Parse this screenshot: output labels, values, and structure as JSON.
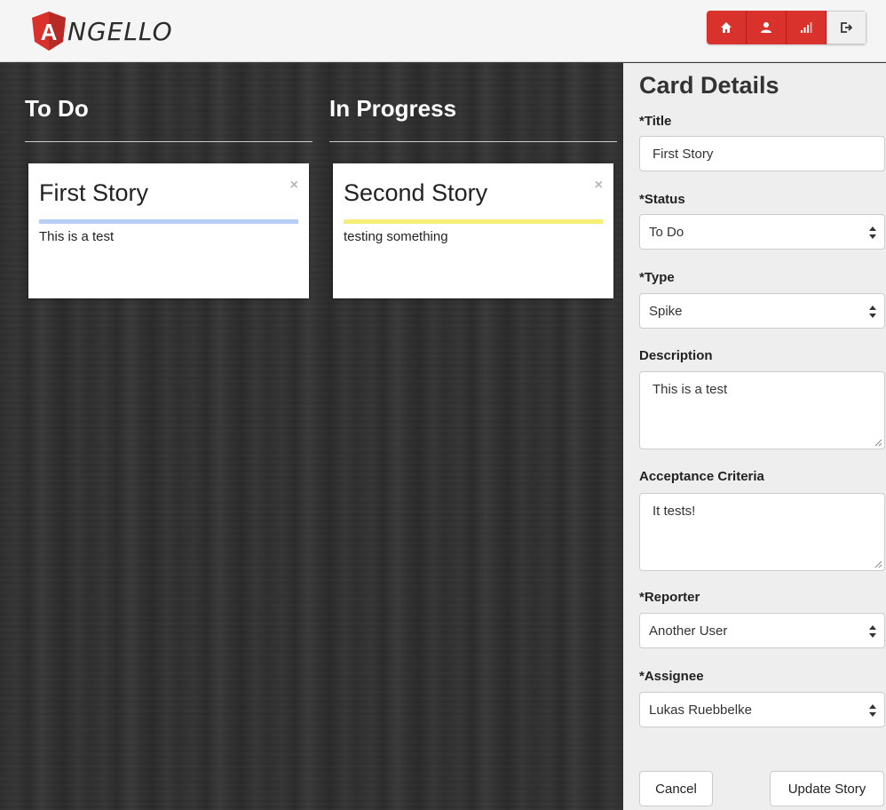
{
  "header": {
    "logo_text": "NGELLO",
    "logo_letter": "A",
    "nav": [
      {
        "icon": "home-icon"
      },
      {
        "icon": "user-icon"
      },
      {
        "icon": "signal-icon"
      },
      {
        "icon": "logout-icon"
      }
    ]
  },
  "board": {
    "columns": [
      {
        "title": "To Do",
        "cards": [
          {
            "title": "First Story",
            "description": "This is a test",
            "bar_color": "#b8cff5",
            "close": "×"
          }
        ]
      },
      {
        "title": "In Progress",
        "cards": [
          {
            "title": "Second Story",
            "description": "testing something",
            "bar_color": "#f7ee78",
            "close": "×"
          }
        ]
      }
    ]
  },
  "details": {
    "heading": "Card Details",
    "title_label": "*Title",
    "title_value": "First Story",
    "status_label": "*Status",
    "status_value": "To Do",
    "type_label": "*Type",
    "type_value": "Spike",
    "description_label": "Description",
    "description_value": "This is a test",
    "criteria_label": "Acceptance Criteria",
    "criteria_value": "It tests!",
    "reporter_label": "*Reporter",
    "reporter_value": "Another User",
    "assignee_label": "*Assignee",
    "assignee_value": "Lukas Ruebbelke",
    "cancel_label": "Cancel",
    "update_label": "Update Story"
  },
  "colors": {
    "brand_red": "#d9322d",
    "todo_bar": "#b8cff5",
    "inprogress_bar": "#f7ee78"
  }
}
